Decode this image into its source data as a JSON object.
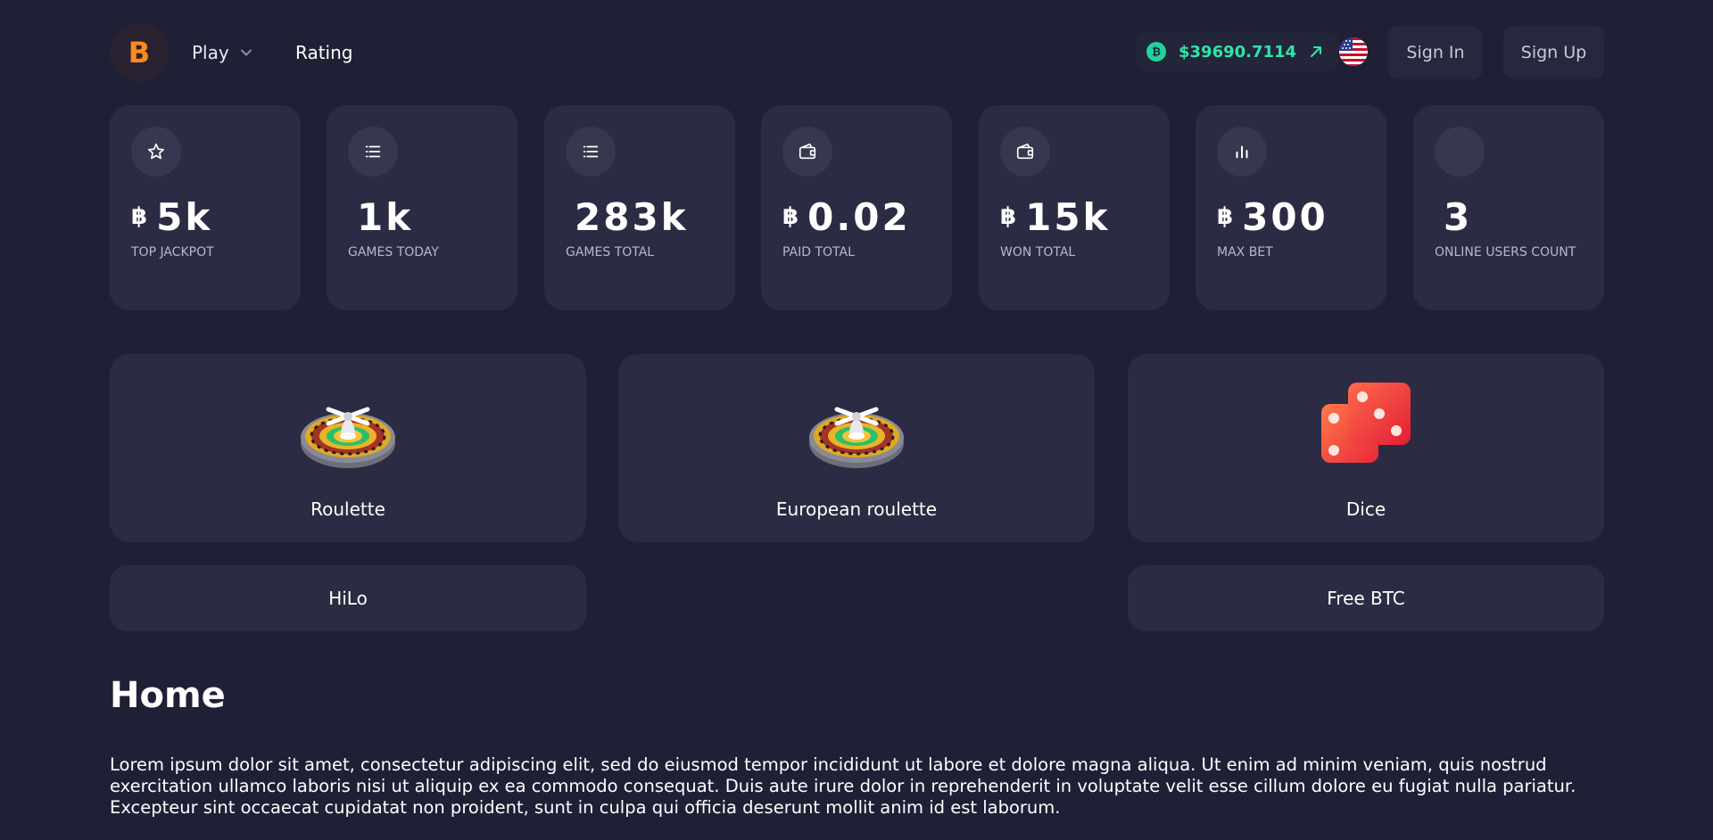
{
  "header": {
    "logo_letter": "B",
    "nav": {
      "play_label": "Play",
      "rating_label": "Rating"
    },
    "btc_price": "$39690.7114",
    "sign_in_label": "Sign In",
    "sign_up_label": "Sign Up"
  },
  "colors": {
    "background": "#1f2035",
    "card": "#2b2c43",
    "accent_orange": "#ff8a1f",
    "price_green": "#2ee6a6"
  },
  "stats": [
    {
      "icon": "star-icon",
      "currency": "฿",
      "value": "5k",
      "label": "TOP JACKPOT"
    },
    {
      "icon": "list-icon",
      "currency": "",
      "value": "1k",
      "label": "GAMES TODAY"
    },
    {
      "icon": "list-icon",
      "currency": "",
      "value": "283k",
      "label": "GAMES TOTAL"
    },
    {
      "icon": "wallet-icon",
      "currency": "฿",
      "value": "0.02",
      "label": "PAID TOTAL"
    },
    {
      "icon": "wallet-icon",
      "currency": "฿",
      "value": "15k",
      "label": "WON TOTAL"
    },
    {
      "icon": "bar-chart-icon",
      "currency": "฿",
      "value": "300",
      "label": "MAX BET"
    },
    {
      "icon": "blank-icon",
      "currency": "",
      "value": "3",
      "label": "ONLINE USERS COUNT"
    }
  ],
  "games": [
    {
      "name": "Roulette",
      "icon": "roulette-icon"
    },
    {
      "name": "European roulette",
      "icon": "roulette-icon"
    },
    {
      "name": "Dice",
      "icon": "dice-icon"
    }
  ],
  "extra_games": [
    {
      "name": "HiLo"
    },
    {
      "name": "Free BTC"
    }
  ],
  "content": {
    "title": "Home",
    "body": "Lorem ipsum dolor sit amet, consectetur adipiscing elit, sed do eiusmod tempor incididunt ut labore et dolore magna aliqua. Ut enim ad minim veniam, quis nostrud exercitation ullamco laboris nisi ut aliquip ex ea commodo consequat. Duis aute irure dolor in reprehenderit in voluptate velit esse cillum dolore eu fugiat nulla pariatur. Excepteur sint occaecat cupidatat non proident, sunt in culpa qui officia deserunt mollit anim id est laborum."
  }
}
